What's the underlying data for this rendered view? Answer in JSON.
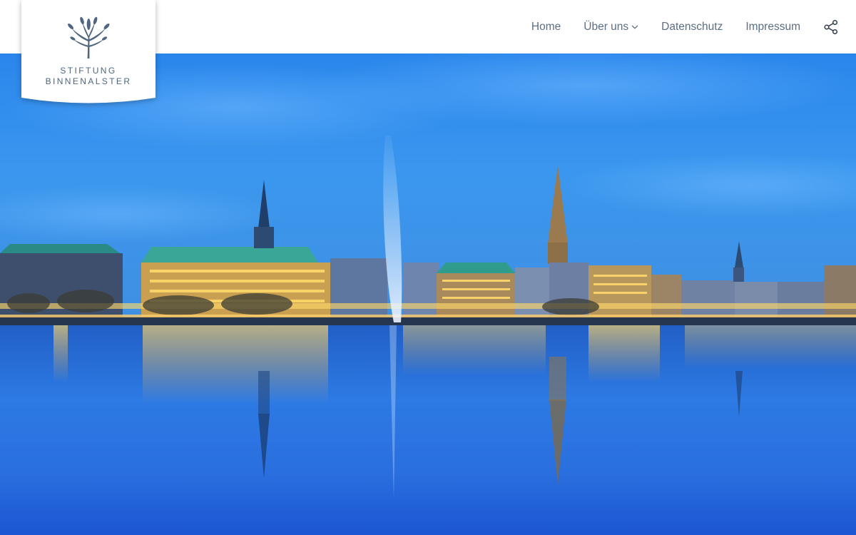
{
  "brand": {
    "line1": "STIFTUNG",
    "line2": "BINNENALSTER",
    "logo_icon": "flower-sprig-icon",
    "color": "#4f6680"
  },
  "nav": {
    "items": [
      {
        "label": "Home",
        "has_dropdown": false
      },
      {
        "label": "Über uns",
        "has_dropdown": true
      },
      {
        "label": "Datenschutz",
        "has_dropdown": false
      },
      {
        "label": "Impressum",
        "has_dropdown": false
      }
    ],
    "share_icon": "share-icon",
    "text_color": "#5b6e84"
  },
  "hero": {
    "subject": "Hamburg Binnenalster skyline at dusk with fountain and reflection",
    "sky_color": "#2f86e8",
    "water_color": "#1c63d8"
  }
}
